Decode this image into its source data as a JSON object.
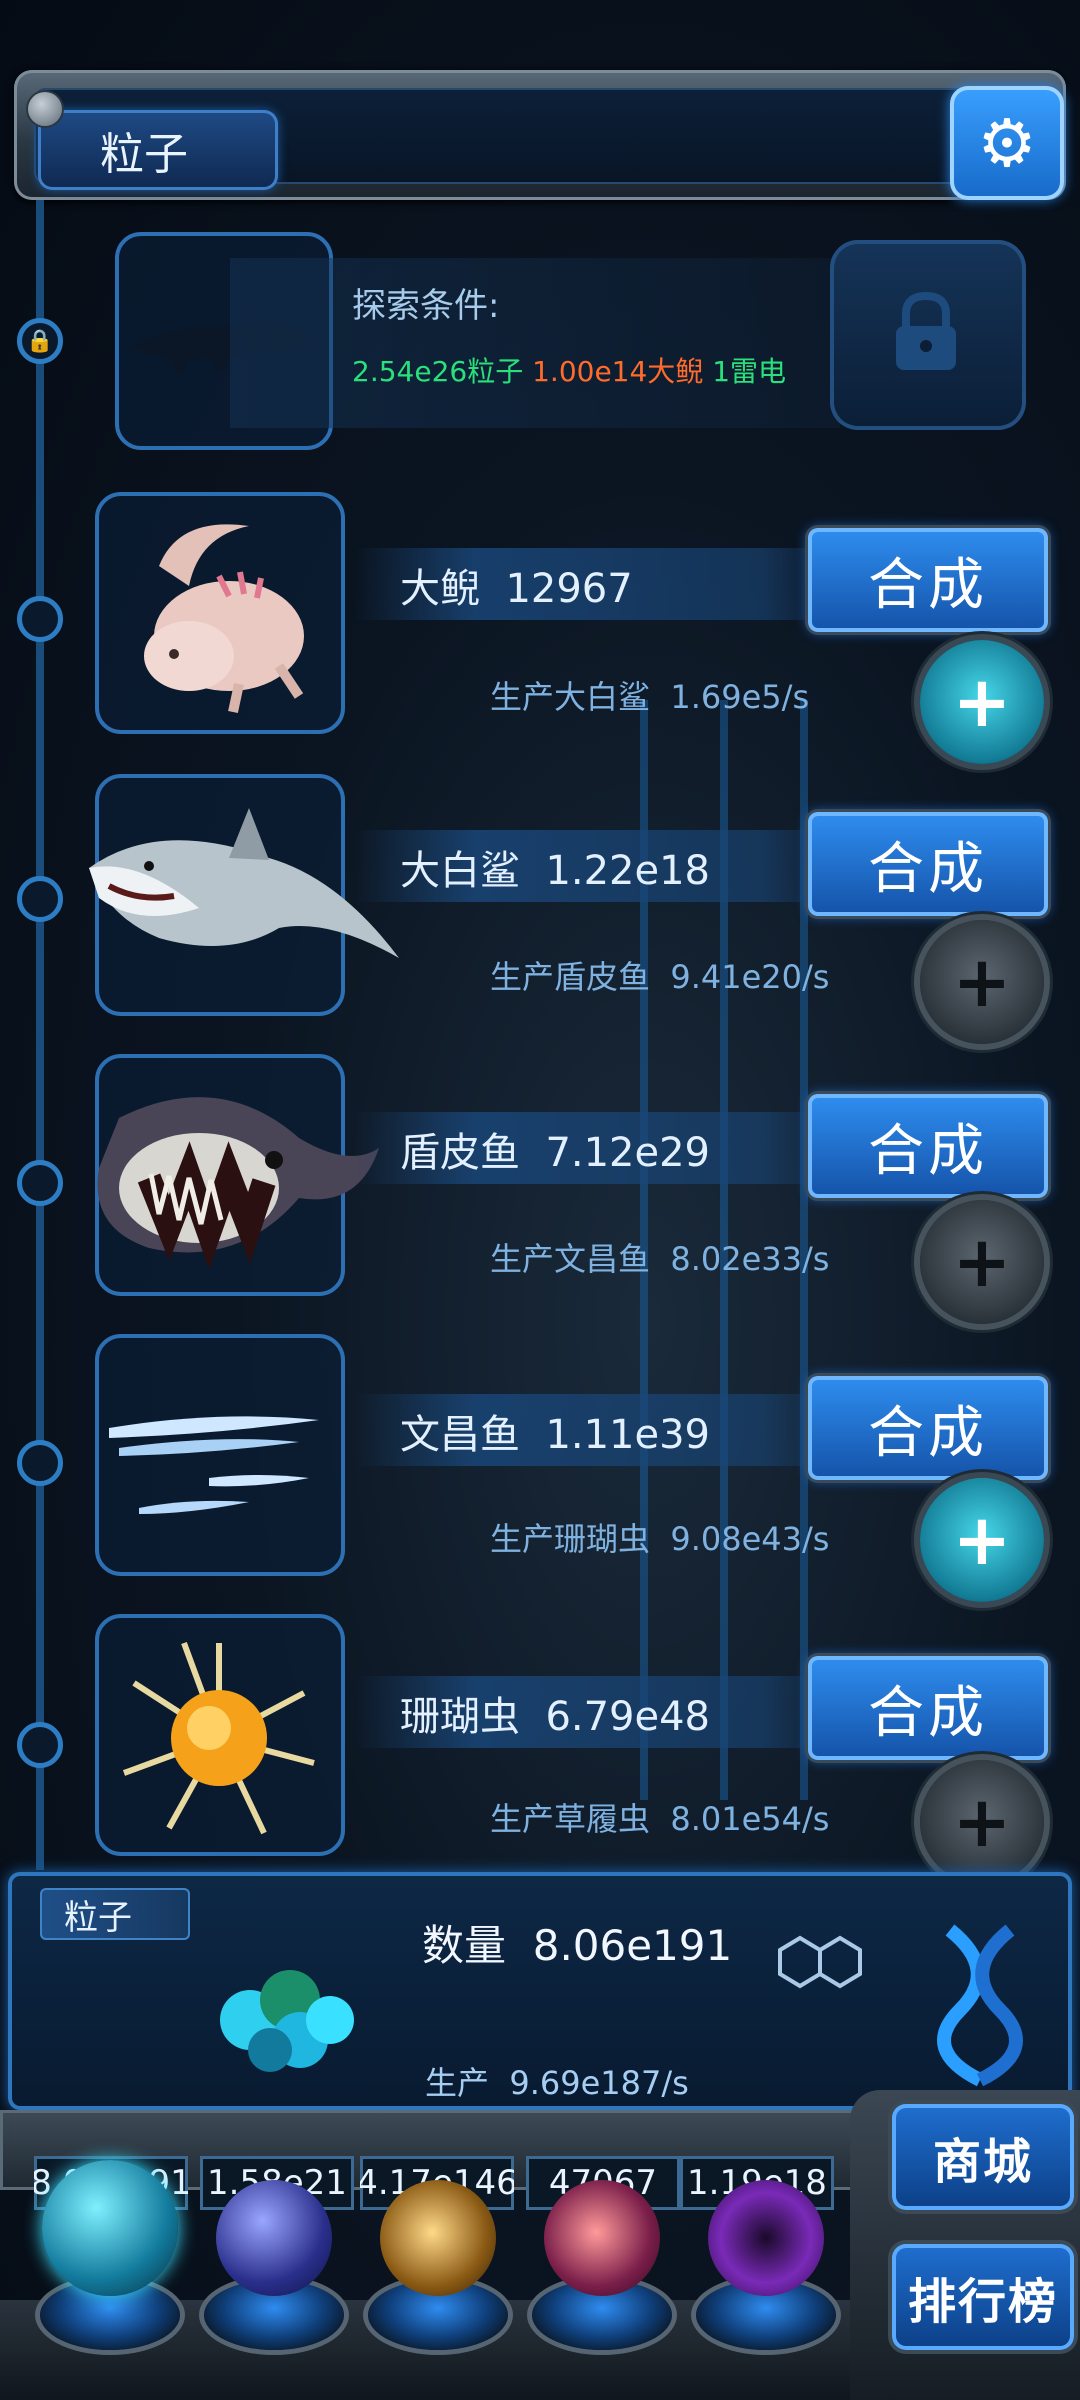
{
  "header": {
    "title": "粒子",
    "settings_icon": "gear-icon"
  },
  "explore": {
    "title": "探索条件:",
    "req1": "2.54e26粒子",
    "req2": "1.00e14大鲵",
    "req3": "1雷电",
    "locked_creature": "crocodile-silhouette",
    "lock_icon": "lock-icon"
  },
  "creatures": [
    {
      "name": "大鲵",
      "count": "12967",
      "prod_label": "生产大白鲨",
      "prod_rate": "1.69e5/s",
      "merge_label": "合成",
      "plus_active": true
    },
    {
      "name": "大白鲨",
      "count": "1.22e18",
      "prod_label": "生产盾皮鱼",
      "prod_rate": "9.41e20/s",
      "merge_label": "合成",
      "plus_active": false
    },
    {
      "name": "盾皮鱼",
      "count": "7.12e29",
      "prod_label": "生产文昌鱼",
      "prod_rate": "8.02e33/s",
      "merge_label": "合成",
      "plus_active": false
    },
    {
      "name": "文昌鱼",
      "count": "1.11e39",
      "prod_label": "生产珊瑚虫",
      "prod_rate": "9.08e43/s",
      "merge_label": "合成",
      "plus_active": true
    },
    {
      "name": "珊瑚虫",
      "count": "6.79e48",
      "prod_label": "生产草履虫",
      "prod_rate": "8.01e54/s",
      "merge_label": "合成",
      "plus_active": false
    }
  ],
  "particle_panel": {
    "tag": "粒子",
    "qty_label": "数量",
    "qty_value": "8.06e191",
    "prod_label": "生产",
    "prod_value": "9.69e187/s"
  },
  "resources": [
    {
      "value": "8.06e191",
      "icon": "particle-orb"
    },
    {
      "value": "1.58e21",
      "icon": "lightning-orb"
    },
    {
      "value": "4.17e146",
      "icon": "galaxy-orb"
    },
    {
      "value": "47067",
      "icon": "brain-orb"
    },
    {
      "value": "1.19e18",
      "icon": "portal-orb"
    }
  ],
  "side_buttons": {
    "shop": "商城",
    "rank": "排行榜"
  },
  "colors": {
    "accent": "#2f8ef0",
    "green": "#29e07b",
    "orange": "#ff6b2b"
  }
}
